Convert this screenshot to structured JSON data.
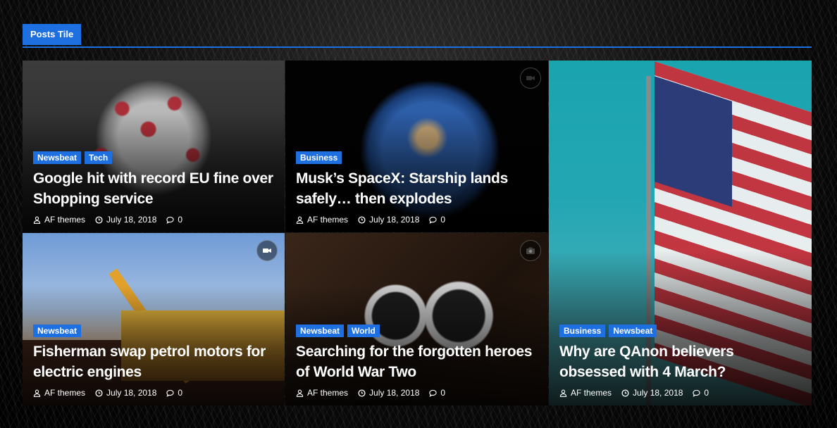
{
  "section": {
    "title": "Posts Tile"
  },
  "accent_color": "#1e6fe0",
  "posts": [
    {
      "categories": [
        "Newsbeat",
        "Tech"
      ],
      "title": "Google hit with record EU fine over Shopping service",
      "author": "AF themes",
      "date": "July 18, 2018",
      "comments": "0",
      "media_icon": null
    },
    {
      "categories": [
        "Business"
      ],
      "title": "Musk’s SpaceX: Starship lands safely… then explodes",
      "author": "AF themes",
      "date": "July 18, 2018",
      "comments": "0",
      "media_icon": "video-icon"
    },
    {
      "categories": [
        "Business",
        "Newsbeat"
      ],
      "title": "Why are QAnon believers obsessed with 4 March?",
      "author": "AF themes",
      "date": "July 18, 2018",
      "comments": "0",
      "media_icon": null
    },
    {
      "categories": [
        "Newsbeat"
      ],
      "title": "Fisherman swap petrol motors for electric engines",
      "author": "AF themes",
      "date": "July 18, 2018",
      "comments": "0",
      "media_icon": "video-icon"
    },
    {
      "categories": [
        "Newsbeat",
        "World"
      ],
      "title": "Searching for the forgotten heroes of World War Two",
      "author": "AF themes",
      "date": "July 18, 2018",
      "comments": "0",
      "media_icon": "camera-icon"
    }
  ]
}
